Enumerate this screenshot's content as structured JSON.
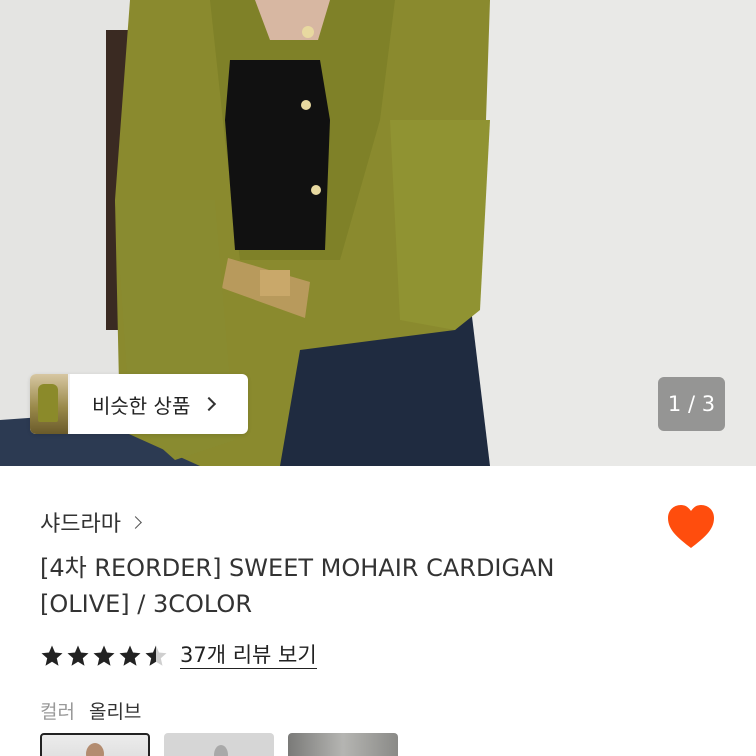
{
  "hero": {
    "similar_label": "비슷한 상품",
    "page_indicator": "1 / 3"
  },
  "product": {
    "brand": "샤드라마",
    "title_line1": "[4차 REORDER] SWEET MOHAIR CARDIGAN",
    "title_line2": "[OLIVE] / 3COLOR",
    "rating": 4.5,
    "review_link": "37개 리뷰 보기",
    "color_label": "컬러",
    "color_value": "올리브",
    "liked": true
  },
  "colors": {
    "heart": "#ff4d0d",
    "star": "#222222",
    "sweater": "#8a8a2e"
  }
}
